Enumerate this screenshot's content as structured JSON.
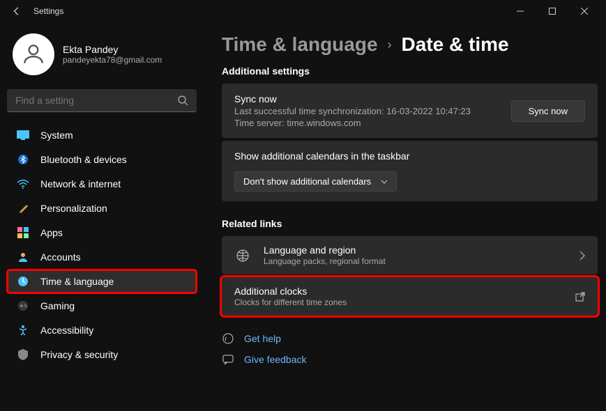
{
  "window": {
    "title": "Settings"
  },
  "profile": {
    "name": "Ekta Pandey",
    "email": "pandeyekta78@gmail.com"
  },
  "search": {
    "placeholder": "Find a setting"
  },
  "sidebar": {
    "items": [
      {
        "label": "System"
      },
      {
        "label": "Bluetooth & devices"
      },
      {
        "label": "Network & internet"
      },
      {
        "label": "Personalization"
      },
      {
        "label": "Apps"
      },
      {
        "label": "Accounts"
      },
      {
        "label": "Time & language"
      },
      {
        "label": "Gaming"
      },
      {
        "label": "Accessibility"
      },
      {
        "label": "Privacy & security"
      }
    ]
  },
  "breadcrumb": {
    "parent": "Time & language",
    "current": "Date & time"
  },
  "sections": {
    "additional_heading": "Additional settings",
    "sync": {
      "title": "Sync now",
      "last_sync": "Last successful time synchronization: 16-03-2022 10:47:23",
      "server": "Time server: time.windows.com",
      "button": "Sync now"
    },
    "calendars": {
      "label": "Show additional calendars in the taskbar",
      "selected": "Don't show additional calendars"
    },
    "related_heading": "Related links",
    "lang_region": {
      "title": "Language and region",
      "sub": "Language packs, regional format"
    },
    "add_clocks": {
      "title": "Additional clocks",
      "sub": "Clocks for different time zones"
    },
    "help": {
      "get_help": "Get help",
      "feedback": "Give feedback"
    }
  }
}
